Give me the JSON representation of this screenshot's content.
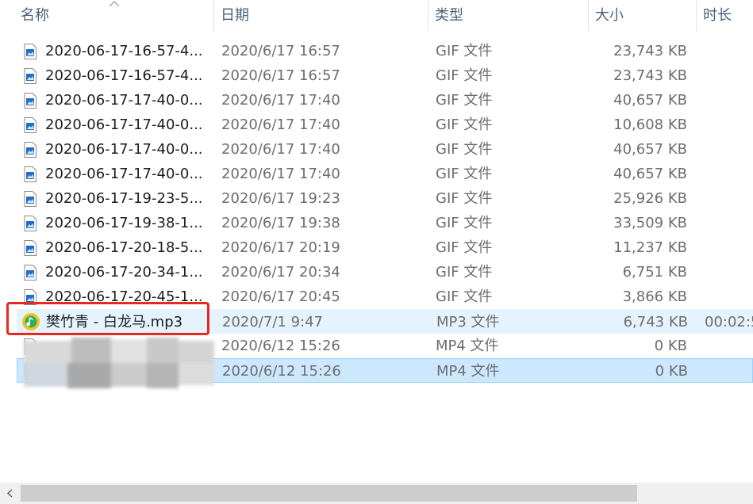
{
  "columns": {
    "name": "名称",
    "date": "日期",
    "type": "类型",
    "size": "大小",
    "length": "时长"
  },
  "files": [
    {
      "name": "2020-06-17-16-57-4...",
      "date": "2020/6/17 16:57",
      "type": "GIF 文件",
      "size": "23,743 KB",
      "length": "",
      "icon": "gif-file-icon"
    },
    {
      "name": "2020-06-17-16-57-4...",
      "date": "2020/6/17 16:57",
      "type": "GIF 文件",
      "size": "23,743 KB",
      "length": "",
      "icon": "gif-file-icon"
    },
    {
      "name": "2020-06-17-17-40-0...",
      "date": "2020/6/17 17:40",
      "type": "GIF 文件",
      "size": "40,657 KB",
      "length": "",
      "icon": "gif-file-icon"
    },
    {
      "name": "2020-06-17-17-40-0...",
      "date": "2020/6/17 17:40",
      "type": "GIF 文件",
      "size": "10,608 KB",
      "length": "",
      "icon": "gif-file-icon"
    },
    {
      "name": "2020-06-17-17-40-0...",
      "date": "2020/6/17 17:40",
      "type": "GIF 文件",
      "size": "40,657 KB",
      "length": "",
      "icon": "gif-file-icon"
    },
    {
      "name": "2020-06-17-17-40-0...",
      "date": "2020/6/17 17:40",
      "type": "GIF 文件",
      "size": "40,657 KB",
      "length": "",
      "icon": "gif-file-icon"
    },
    {
      "name": "2020-06-17-19-23-5...",
      "date": "2020/6/17 19:23",
      "type": "GIF 文件",
      "size": "25,926 KB",
      "length": "",
      "icon": "gif-file-icon"
    },
    {
      "name": "2020-06-17-19-38-1...",
      "date": "2020/6/17 19:38",
      "type": "GIF 文件",
      "size": "33,509 KB",
      "length": "",
      "icon": "gif-file-icon"
    },
    {
      "name": "2020-06-17-20-18-5...",
      "date": "2020/6/17 20:19",
      "type": "GIF 文件",
      "size": "11,237 KB",
      "length": "",
      "icon": "gif-file-icon"
    },
    {
      "name": "2020-06-17-20-34-1...",
      "date": "2020/6/17 20:34",
      "type": "GIF 文件",
      "size": "6,751 KB",
      "length": "",
      "icon": "gif-file-icon"
    },
    {
      "name": "2020-06-17-20-45-1...",
      "date": "2020/6/17 20:45",
      "type": "GIF 文件",
      "size": "3,866 KB",
      "length": "",
      "icon": "gif-file-icon"
    },
    {
      "name": "樊竹青 - 白龙马.mp3",
      "date": "2020/7/1 9:47",
      "type": "MP3 文件",
      "size": "6,743 KB",
      "length": "00:02:5",
      "icon": "qq-music-file-icon"
    },
    {
      "name": "",
      "date": "2020/6/12 15:26",
      "type": "MP4 文件",
      "size": "0 KB",
      "length": "",
      "icon": "mp4-file-icon"
    },
    {
      "name": "",
      "date": "2020/6/12 15:26",
      "type": "MP4 文件",
      "size": "0 KB",
      "length": "",
      "icon": "mp4-file-icon"
    }
  ],
  "colors": {
    "selected_bg": "#cce8ff",
    "hover_bg": "#e5f3ff",
    "highlight_border": "#e8281e",
    "header_text": "#4c607a",
    "detail_text": "#6d6d6d"
  }
}
